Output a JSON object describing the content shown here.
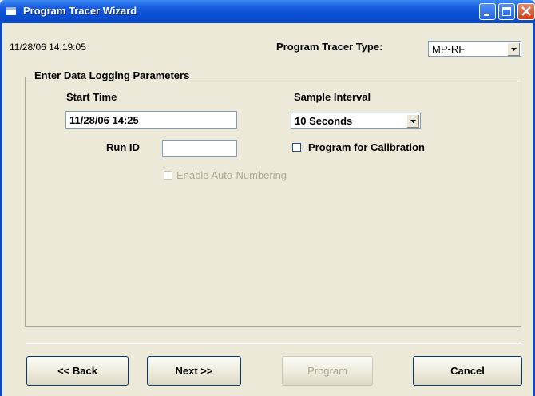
{
  "window": {
    "title": "Program Tracer Wizard"
  },
  "header": {
    "timestamp": "11/28/06 14:19:05",
    "tracer_type_label": "Program Tracer Type:",
    "tracer_type_value": "MP-RF"
  },
  "group": {
    "title": "Enter Data Logging Parameters",
    "start_time_label": "Start Time",
    "start_time_value": "11/28/06 14:25",
    "sample_interval_label": "Sample Interval",
    "sample_interval_value": "10 Seconds",
    "run_id_label": "Run ID",
    "run_id_value": "",
    "calibration_label": "Program for Calibration",
    "calibration_checked": false,
    "auto_numbering_label": "Enable Auto-Numbering",
    "auto_numbering_checked": false
  },
  "buttons": {
    "back": "<< Back",
    "next": "Next >>",
    "program": "Program",
    "cancel": "Cancel"
  },
  "icons": {
    "app": "app-icon",
    "minimize": "minimize-icon",
    "maximize": "maximize-icon",
    "close": "close-icon",
    "dropdown": "chevron-down-icon"
  },
  "colors": {
    "titlebar": "#0a50d6",
    "window_bg": "#ece9d8",
    "disabled_text": "#aca899"
  }
}
